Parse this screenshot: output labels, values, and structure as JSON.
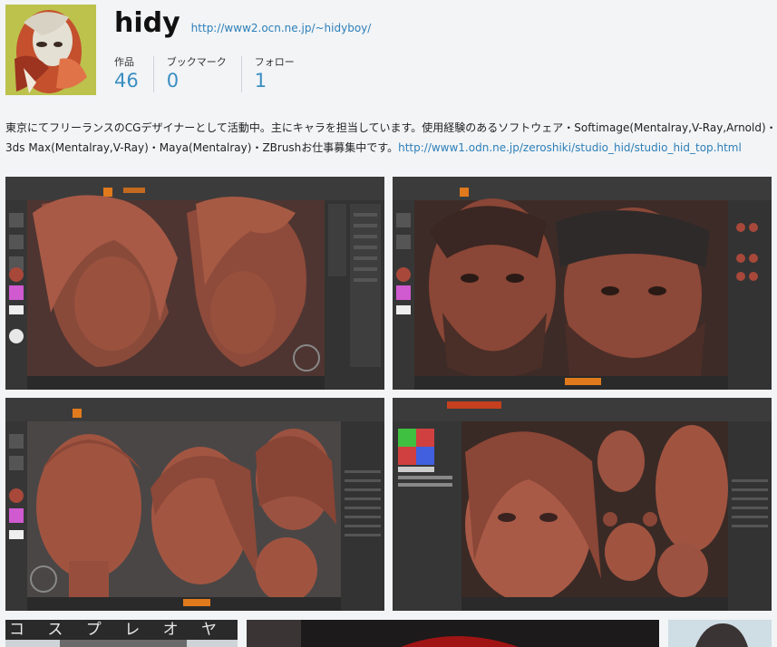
{
  "profile": {
    "name": "hidy",
    "site_url": "http://www2.ocn.ne.jp/~hidyboy/"
  },
  "stats": [
    {
      "label": "作品",
      "value": "46"
    },
    {
      "label": "ブックマーク",
      "value": "0"
    },
    {
      "label": "フォロー",
      "value": "1"
    }
  ],
  "bio": {
    "text": "東京にてフリーランスのCGデザイナーとして活動中。主にキャラを担当しています。使用経験のあるソフトウェア・Softimage(Mentalray,V-Ray,Arnold)・3ds Max(Mentalray,V-Ray)・Maya(Mentalray)・ZBrushお仕事募集中です。",
    "link": "http://www1.odn.ne.jp/zeroshiki/studio_hid/studio_hid_top.html"
  },
  "works": [
    {
      "name": "work-zbrush-anime-heads"
    },
    {
      "name": "work-zbrush-bearded-soldiers"
    },
    {
      "name": "work-zbrush-female-heads"
    },
    {
      "name": "work-zbrush-female-portrait"
    }
  ],
  "bottom_works": [
    {
      "name": "work-cosplay-oyaji",
      "caption": "コ ス プ レ オ ヤ ジ"
    },
    {
      "name": "work-dark-red"
    },
    {
      "name": "work-light-portrait"
    }
  ],
  "colors": {
    "accent": "#3a8ec2",
    "link": "#2e7fb8",
    "clay": "#b65a45",
    "zbrush_bg": "#2c2c2c"
  }
}
